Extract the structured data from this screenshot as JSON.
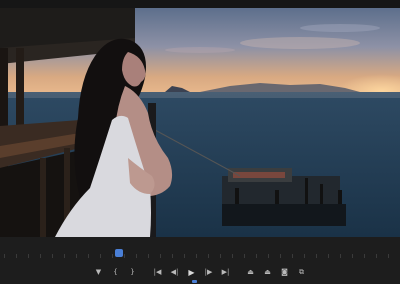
{
  "monitor": {
    "title": "",
    "accent_color": "#4a7fd6"
  },
  "transport": {
    "buttons": [
      {
        "name": "add-marker-icon",
        "glyph": "▼"
      },
      {
        "name": "mark-in-icon",
        "glyph": "{"
      },
      {
        "name": "mark-out-icon",
        "glyph": "}"
      },
      {
        "name": "go-to-in-icon",
        "glyph": "|◀"
      },
      {
        "name": "step-back-icon",
        "glyph": "◀|"
      },
      {
        "name": "play-icon",
        "glyph": "▶"
      },
      {
        "name": "step-forward-icon",
        "glyph": "|▶"
      },
      {
        "name": "go-to-out-icon",
        "glyph": "▶|"
      },
      {
        "name": "lift-icon",
        "glyph": "⏏"
      },
      {
        "name": "extract-icon",
        "glyph": "⏏"
      },
      {
        "name": "export-frame-icon",
        "glyph": "◙"
      },
      {
        "name": "compare-icon",
        "glyph": "⧉"
      }
    ]
  },
  "playback": {
    "playhead_fraction": 0.3
  }
}
